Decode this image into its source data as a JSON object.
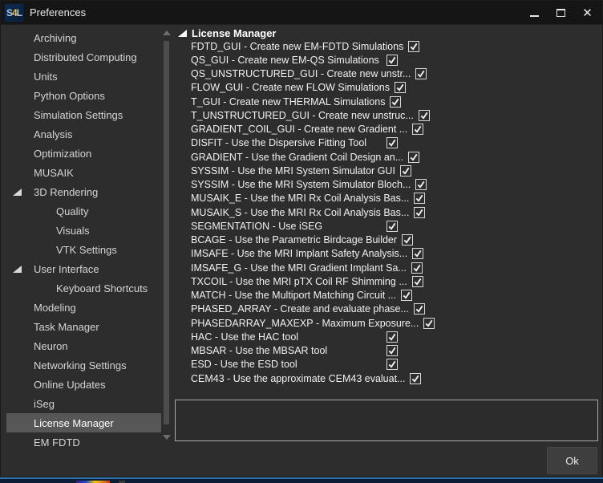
{
  "window": {
    "title": "Preferences",
    "badge": {
      "s": "S",
      "four": "4",
      "l": "L"
    }
  },
  "sidebar": {
    "items": [
      {
        "label": "Archiving",
        "level": 0,
        "expandable": false,
        "selected": false
      },
      {
        "label": "Distributed Computing",
        "level": 0,
        "expandable": false,
        "selected": false
      },
      {
        "label": "Units",
        "level": 0,
        "expandable": false,
        "selected": false
      },
      {
        "label": "Python Options",
        "level": 0,
        "expandable": false,
        "selected": false
      },
      {
        "label": "Simulation Settings",
        "level": 0,
        "expandable": false,
        "selected": false
      },
      {
        "label": "Analysis",
        "level": 0,
        "expandable": false,
        "selected": false
      },
      {
        "label": "Optimization",
        "level": 0,
        "expandable": false,
        "selected": false
      },
      {
        "label": "MUSAIK",
        "level": 0,
        "expandable": false,
        "selected": false
      },
      {
        "label": "3D Rendering",
        "level": 0,
        "expandable": true,
        "selected": false
      },
      {
        "label": "Quality",
        "level": 1,
        "expandable": false,
        "selected": false
      },
      {
        "label": "Visuals",
        "level": 1,
        "expandable": false,
        "selected": false
      },
      {
        "label": "VTK Settings",
        "level": 1,
        "expandable": false,
        "selected": false
      },
      {
        "label": "User Interface",
        "level": 0,
        "expandable": true,
        "selected": false
      },
      {
        "label": "Keyboard Shortcuts",
        "level": 1,
        "expandable": false,
        "selected": false
      },
      {
        "label": "Modeling",
        "level": 0,
        "expandable": false,
        "selected": false
      },
      {
        "label": "Task Manager",
        "level": 0,
        "expandable": false,
        "selected": false
      },
      {
        "label": "Neuron",
        "level": 0,
        "expandable": false,
        "selected": false
      },
      {
        "label": "Networking Settings",
        "level": 0,
        "expandable": false,
        "selected": false
      },
      {
        "label": "Online Updates",
        "level": 0,
        "expandable": false,
        "selected": false
      },
      {
        "label": "iSeg",
        "level": 0,
        "expandable": false,
        "selected": false
      },
      {
        "label": "License Manager",
        "level": 0,
        "expandable": false,
        "selected": true
      },
      {
        "label": "EM FDTD",
        "level": 0,
        "expandable": false,
        "selected": false
      }
    ]
  },
  "license_panel": {
    "header": "License Manager",
    "items": [
      {
        "label": "FDTD_GUI - Create new EM-FDTD Simulations",
        "checked": true
      },
      {
        "label": "QS_GUI - Create new EM-QS Simulations",
        "checked": true
      },
      {
        "label": "QS_UNSTRUCTURED_GUI - Create new unstr...",
        "checked": true
      },
      {
        "label": "FLOW_GUI - Create new FLOW Simulations",
        "checked": true
      },
      {
        "label": "T_GUI - Create new THERMAL Simulations",
        "checked": true
      },
      {
        "label": "T_UNSTRUCTURED_GUI - Create new unstruc...",
        "checked": true
      },
      {
        "label": "GRADIENT_COIL_GUI - Create new Gradient ...",
        "checked": true
      },
      {
        "label": "DISFIT - Use the Dispersive Fitting Tool",
        "checked": true
      },
      {
        "label": "GRADIENT - Use the Gradient Coil Design an...",
        "checked": true
      },
      {
        "label": "SYSSIM - Use the MRI System Simulator GUI",
        "checked": true
      },
      {
        "label": "SYSSIM - Use the MRI System Simulator Bloch...",
        "checked": true
      },
      {
        "label": "MUSAIK_E - Use the MRI Rx Coil Analysis Bas...",
        "checked": true
      },
      {
        "label": "MUSAIK_S - Use the MRI Rx Coil Analysis Bas...",
        "checked": true
      },
      {
        "label": "SEGMENTATION - Use iSEG",
        "checked": true
      },
      {
        "label": "BCAGE - Use the Parametric Birdcage Builder",
        "checked": true
      },
      {
        "label": "IMSAFE - Use the MRI Implant Safety Analysis...",
        "checked": true
      },
      {
        "label": "IMSAFE_G - Use the MRI Gradient Implant Sa...",
        "checked": true
      },
      {
        "label": "TXCOIL - Use the MRI pTX Coil RF Shimming ...",
        "checked": true
      },
      {
        "label": "MATCH - Use the Multiport Matching Circuit ...",
        "checked": true
      },
      {
        "label": "PHASED_ARRAY - Create and evaluate phase...",
        "checked": true
      },
      {
        "label": "PHASEDARRAY_MAXEXP - Maximum Exposure...",
        "checked": true
      },
      {
        "label": "HAC - Use the HAC tool",
        "checked": true
      },
      {
        "label": "MBSAR - Use the MBSAR tool",
        "checked": true
      },
      {
        "label": "ESD - Use the ESD tool",
        "checked": true
      },
      {
        "label": "CEM43 - Use the approximate CEM43 evaluat...",
        "checked": true
      }
    ]
  },
  "description_box": {
    "value": ""
  },
  "footer": {
    "ok_label": "Ok"
  },
  "colors": {
    "dialog_bg": "#2d2d2d",
    "titlebar_bg": "#151515",
    "selection_bg": "#575757",
    "badge_yellow": "#f2c12e",
    "badge_blue": "#a9c7e4",
    "taskbar_accent": "#2d71ac"
  }
}
